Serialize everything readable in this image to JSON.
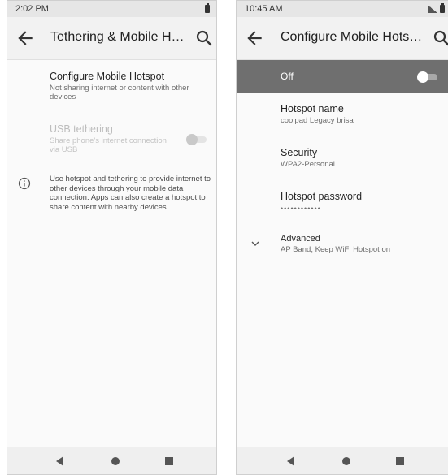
{
  "left_screen": {
    "status_time": "2:02 PM",
    "title": "Tethering & Mobile Hotspot",
    "configure": {
      "title": "Configure Mobile Hotspot",
      "summary": "Not sharing internet or content with other devices"
    },
    "usb_tethering": {
      "title": "USB tethering",
      "summary": "Share phone's internet connection via USB",
      "enabled": false
    },
    "info_text": "Use hotspot and tethering to provide internet to other devices through your mobile data connection. Apps can also create a hotspot to share content with nearby devices."
  },
  "right_screen": {
    "status_time": "10:45 AM",
    "title": "Configure Mobile Hotspot",
    "master_switch": {
      "label": "Off",
      "on": false
    },
    "hotspot_name": {
      "title": "Hotspot name",
      "value": "coolpad Legacy brisa"
    },
    "security": {
      "title": "Security",
      "value": "WPA2-Personal"
    },
    "hotspot_password": {
      "title": "Hotspot password",
      "value": "••••••••••••"
    },
    "advanced": {
      "title": "Advanced",
      "summary": "AP Band, Keep WiFi Hotspot on"
    }
  },
  "icons": {
    "back": "arrow-back-icon",
    "search": "search-icon",
    "info": "info-icon",
    "expand": "chevron-down-icon",
    "battery": "battery-icon",
    "signal": "signal-icon"
  },
  "colors": {
    "master_bar": "#6f6f6f",
    "app_bar": "#f2f2f2",
    "status_bar": "#e6e6e6",
    "background": "#fafafa"
  }
}
